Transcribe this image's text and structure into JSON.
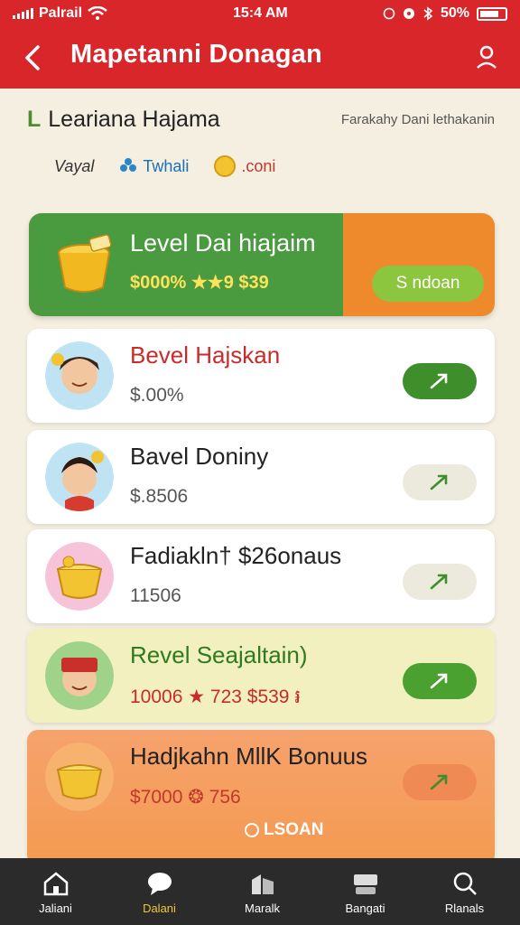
{
  "status": {
    "carrier": "Palrail",
    "time": "15:4 AM",
    "battery": "50%"
  },
  "header": {
    "title": "Mapetanni Donagan"
  },
  "info": {
    "mark": "L",
    "title": "Leariana Hajama",
    "subtitle": "Farakahy Dani lethakanin",
    "chips": [
      "Vayal",
      "Twhali",
      ".coni"
    ]
  },
  "hero": {
    "title": "Level Dai hiajaim",
    "meta": "$000% ★★9 $39",
    "button": "S ndoan"
  },
  "cards": [
    {
      "title": "Bevel Hajskan",
      "subtitle": "$.00%",
      "title_color": "#c92a2a"
    },
    {
      "title": "Bavel Doniny",
      "subtitle": "$.8506",
      "title_color": "#222222"
    },
    {
      "title": "Fadiakln† $26onaus",
      "subtitle": "11506",
      "title_color": "#222222"
    },
    {
      "title": "Revel Seajaltain)",
      "subtitle": "10006 ★ 723 $539 ៛",
      "title_color": "#2f7a1f"
    },
    {
      "title": "Hadjkahn MllK Bonuus",
      "subtitle": "$7000 ❂ 756",
      "title_color": "#222222",
      "extra": "LSOAN"
    }
  ],
  "nav": [
    {
      "label": "Jaliani",
      "icon": "home-icon"
    },
    {
      "label": "Dalani",
      "icon": "chat-icon"
    },
    {
      "label": "Maralk",
      "icon": "building-icon"
    },
    {
      "label": "Bangati",
      "icon": "card-icon"
    },
    {
      "label": "Rlanals",
      "icon": "search-icon"
    }
  ],
  "colors": {
    "brand": "#d8262b",
    "green": "#4a9a3f",
    "orange": "#ef8a2c",
    "accent": "#f4c430"
  }
}
